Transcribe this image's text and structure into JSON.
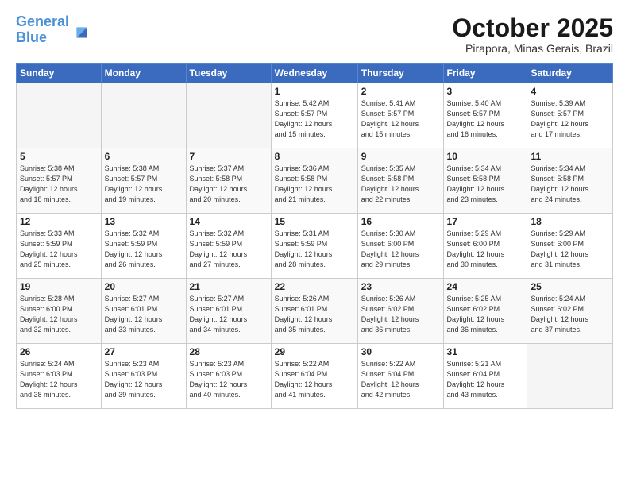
{
  "logo": {
    "line1": "General",
    "line2": "Blue"
  },
  "header": {
    "month": "October 2025",
    "location": "Pirapora, Minas Gerais, Brazil"
  },
  "weekdays": [
    "Sunday",
    "Monday",
    "Tuesday",
    "Wednesday",
    "Thursday",
    "Friday",
    "Saturday"
  ],
  "weeks": [
    [
      {
        "day": "",
        "info": ""
      },
      {
        "day": "",
        "info": ""
      },
      {
        "day": "",
        "info": ""
      },
      {
        "day": "1",
        "info": "Sunrise: 5:42 AM\nSunset: 5:57 PM\nDaylight: 12 hours\nand 15 minutes."
      },
      {
        "day": "2",
        "info": "Sunrise: 5:41 AM\nSunset: 5:57 PM\nDaylight: 12 hours\nand 15 minutes."
      },
      {
        "day": "3",
        "info": "Sunrise: 5:40 AM\nSunset: 5:57 PM\nDaylight: 12 hours\nand 16 minutes."
      },
      {
        "day": "4",
        "info": "Sunrise: 5:39 AM\nSunset: 5:57 PM\nDaylight: 12 hours\nand 17 minutes."
      }
    ],
    [
      {
        "day": "5",
        "info": "Sunrise: 5:38 AM\nSunset: 5:57 PM\nDaylight: 12 hours\nand 18 minutes."
      },
      {
        "day": "6",
        "info": "Sunrise: 5:38 AM\nSunset: 5:57 PM\nDaylight: 12 hours\nand 19 minutes."
      },
      {
        "day": "7",
        "info": "Sunrise: 5:37 AM\nSunset: 5:58 PM\nDaylight: 12 hours\nand 20 minutes."
      },
      {
        "day": "8",
        "info": "Sunrise: 5:36 AM\nSunset: 5:58 PM\nDaylight: 12 hours\nand 21 minutes."
      },
      {
        "day": "9",
        "info": "Sunrise: 5:35 AM\nSunset: 5:58 PM\nDaylight: 12 hours\nand 22 minutes."
      },
      {
        "day": "10",
        "info": "Sunrise: 5:34 AM\nSunset: 5:58 PM\nDaylight: 12 hours\nand 23 minutes."
      },
      {
        "day": "11",
        "info": "Sunrise: 5:34 AM\nSunset: 5:58 PM\nDaylight: 12 hours\nand 24 minutes."
      }
    ],
    [
      {
        "day": "12",
        "info": "Sunrise: 5:33 AM\nSunset: 5:59 PM\nDaylight: 12 hours\nand 25 minutes."
      },
      {
        "day": "13",
        "info": "Sunrise: 5:32 AM\nSunset: 5:59 PM\nDaylight: 12 hours\nand 26 minutes."
      },
      {
        "day": "14",
        "info": "Sunrise: 5:32 AM\nSunset: 5:59 PM\nDaylight: 12 hours\nand 27 minutes."
      },
      {
        "day": "15",
        "info": "Sunrise: 5:31 AM\nSunset: 5:59 PM\nDaylight: 12 hours\nand 28 minutes."
      },
      {
        "day": "16",
        "info": "Sunrise: 5:30 AM\nSunset: 6:00 PM\nDaylight: 12 hours\nand 29 minutes."
      },
      {
        "day": "17",
        "info": "Sunrise: 5:29 AM\nSunset: 6:00 PM\nDaylight: 12 hours\nand 30 minutes."
      },
      {
        "day": "18",
        "info": "Sunrise: 5:29 AM\nSunset: 6:00 PM\nDaylight: 12 hours\nand 31 minutes."
      }
    ],
    [
      {
        "day": "19",
        "info": "Sunrise: 5:28 AM\nSunset: 6:00 PM\nDaylight: 12 hours\nand 32 minutes."
      },
      {
        "day": "20",
        "info": "Sunrise: 5:27 AM\nSunset: 6:01 PM\nDaylight: 12 hours\nand 33 minutes."
      },
      {
        "day": "21",
        "info": "Sunrise: 5:27 AM\nSunset: 6:01 PM\nDaylight: 12 hours\nand 34 minutes."
      },
      {
        "day": "22",
        "info": "Sunrise: 5:26 AM\nSunset: 6:01 PM\nDaylight: 12 hours\nand 35 minutes."
      },
      {
        "day": "23",
        "info": "Sunrise: 5:26 AM\nSunset: 6:02 PM\nDaylight: 12 hours\nand 36 minutes."
      },
      {
        "day": "24",
        "info": "Sunrise: 5:25 AM\nSunset: 6:02 PM\nDaylight: 12 hours\nand 36 minutes."
      },
      {
        "day": "25",
        "info": "Sunrise: 5:24 AM\nSunset: 6:02 PM\nDaylight: 12 hours\nand 37 minutes."
      }
    ],
    [
      {
        "day": "26",
        "info": "Sunrise: 5:24 AM\nSunset: 6:03 PM\nDaylight: 12 hours\nand 38 minutes."
      },
      {
        "day": "27",
        "info": "Sunrise: 5:23 AM\nSunset: 6:03 PM\nDaylight: 12 hours\nand 39 minutes."
      },
      {
        "day": "28",
        "info": "Sunrise: 5:23 AM\nSunset: 6:03 PM\nDaylight: 12 hours\nand 40 minutes."
      },
      {
        "day": "29",
        "info": "Sunrise: 5:22 AM\nSunset: 6:04 PM\nDaylight: 12 hours\nand 41 minutes."
      },
      {
        "day": "30",
        "info": "Sunrise: 5:22 AM\nSunset: 6:04 PM\nDaylight: 12 hours\nand 42 minutes."
      },
      {
        "day": "31",
        "info": "Sunrise: 5:21 AM\nSunset: 6:04 PM\nDaylight: 12 hours\nand 43 minutes."
      },
      {
        "day": "",
        "info": ""
      }
    ]
  ]
}
